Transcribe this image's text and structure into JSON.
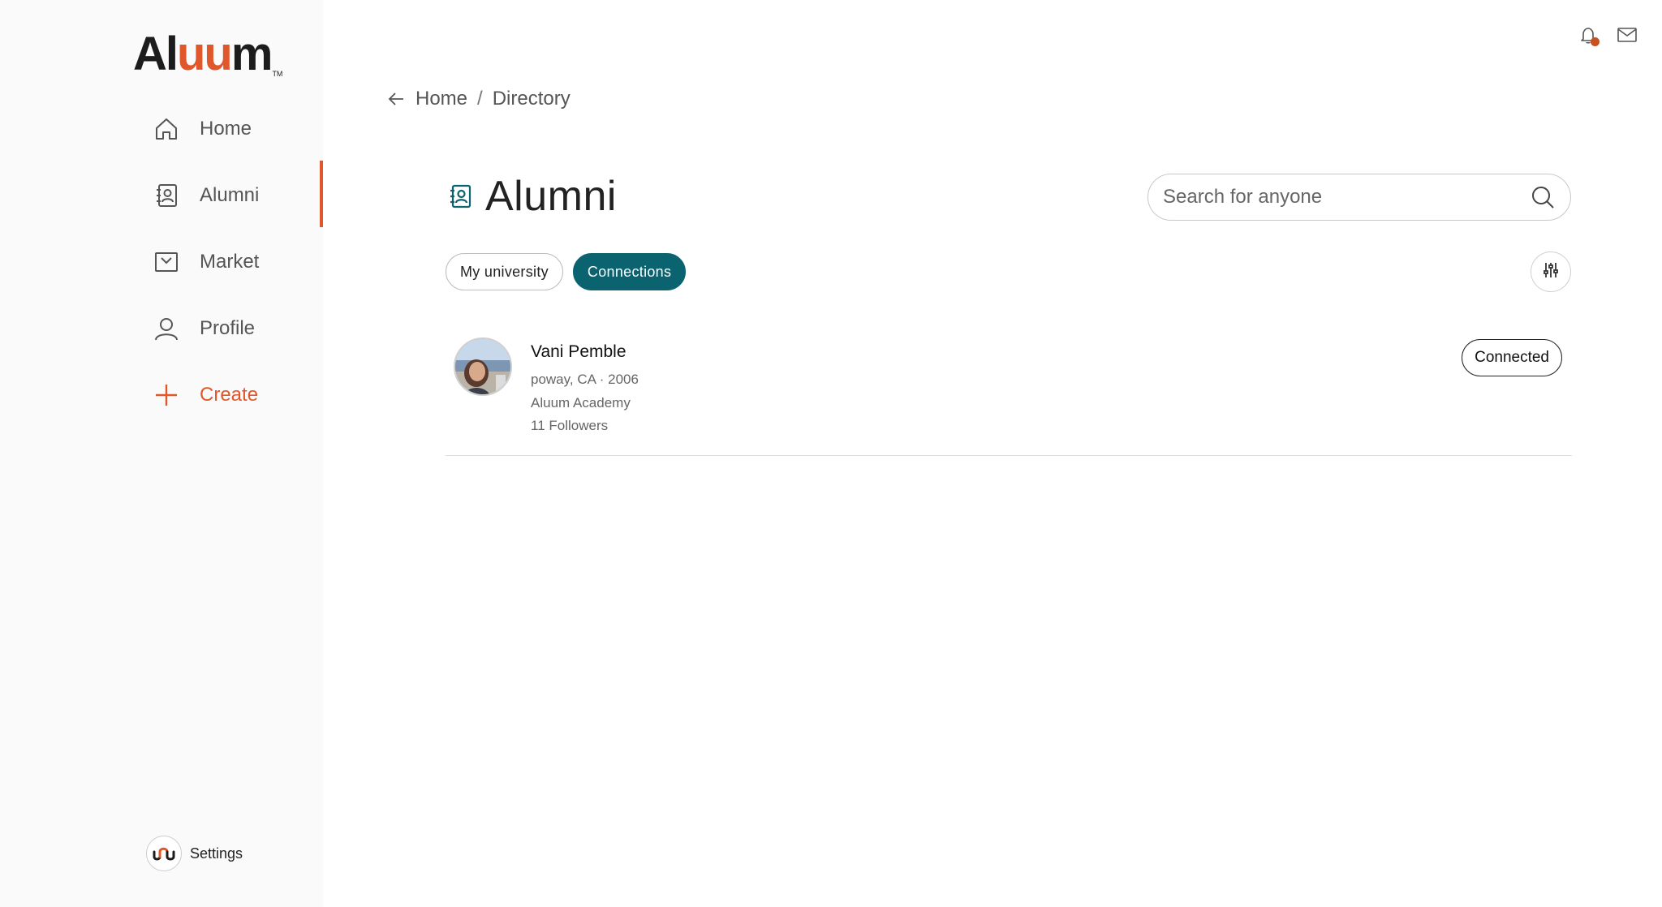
{
  "app": {
    "logo_prefix": "Al",
    "logo_u": "uu",
    "logo_suffix": "m",
    "logo_tm": "TM"
  },
  "sidebar": {
    "items": [
      {
        "label": "Home",
        "icon": "home-icon"
      },
      {
        "label": "Alumni",
        "icon": "contact-book-icon",
        "active": true
      },
      {
        "label": "Market",
        "icon": "market-icon"
      },
      {
        "label": "Profile",
        "icon": "person-icon"
      },
      {
        "label": "Create",
        "icon": "plus-icon"
      }
    ],
    "settings_label": "Settings",
    "accent_color": "#e0572b"
  },
  "header": {
    "notification_icon": "bell-icon",
    "mail_icon": "mail-icon"
  },
  "breadcrumb": {
    "items": [
      "Home",
      "Directory"
    ],
    "separator": "/"
  },
  "page": {
    "title": "Alumni",
    "search_placeholder": "Search for anyone"
  },
  "tabs": [
    {
      "label": "My university",
      "selected": false
    },
    {
      "label": "Connections",
      "selected": true
    }
  ],
  "tab_selected_color": "#0c6370",
  "results": [
    {
      "name": "Vani Pemble",
      "location_year": "poway, CA · 2006",
      "school": "Aluum Academy",
      "followers": "11 Followers",
      "status": "Connected"
    }
  ]
}
